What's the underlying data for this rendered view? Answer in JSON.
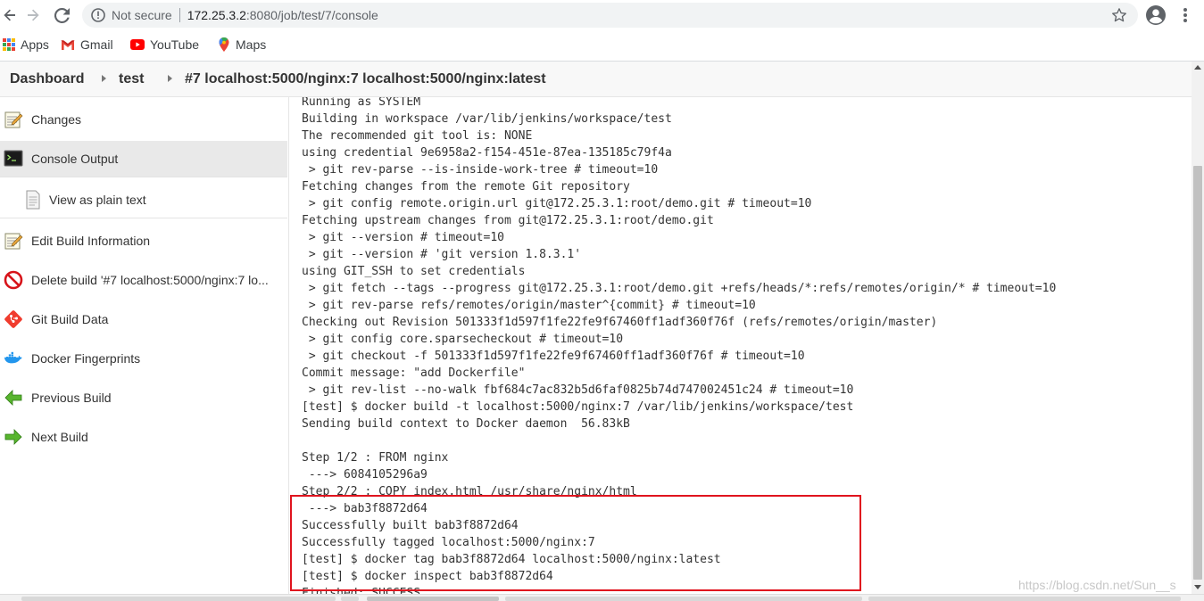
{
  "browser": {
    "security_label": "Not secure",
    "url_host": "172.25.3.2",
    "url_rest": ":8080/job/test/7/console",
    "bookmarks": [
      {
        "label": "Apps",
        "icon": "apps-grid-icon"
      },
      {
        "label": "Gmail",
        "icon": "gmail-icon"
      },
      {
        "label": "YouTube",
        "icon": "youtube-icon"
      },
      {
        "label": "Maps",
        "icon": "maps-icon"
      }
    ]
  },
  "breadcrumb": {
    "items": [
      "Dashboard",
      "test",
      "#7 localhost:5000/nginx:7 localhost:5000/nginx:latest"
    ]
  },
  "sidebar": {
    "items": [
      {
        "label": "Changes",
        "icon": "notepad-icon"
      },
      {
        "label": "Console Output",
        "icon": "terminal-icon",
        "active": true
      },
      {
        "label": "View as plain text",
        "icon": "document-icon",
        "sub": true
      },
      {
        "label": "Edit Build Information",
        "icon": "notepad-icon"
      },
      {
        "label": "Delete build '#7 localhost:5000/nginx:7 lo...",
        "icon": "no-entry-icon"
      },
      {
        "label": "Git Build Data",
        "icon": "git-icon"
      },
      {
        "label": "Docker Fingerprints",
        "icon": "docker-icon"
      },
      {
        "label": "Previous Build",
        "icon": "arrow-left-icon"
      },
      {
        "label": "Next Build",
        "icon": "arrow-right-icon"
      }
    ]
  },
  "console": {
    "lines": [
      "Running as SYSTEM",
      "Building in workspace /var/lib/jenkins/workspace/test",
      "The recommended git tool is: NONE",
      "using credential 9e6958a2-f154-451e-87ea-135185c79f4a",
      " > git rev-parse --is-inside-work-tree # timeout=10",
      "Fetching changes from the remote Git repository",
      " > git config remote.origin.url git@172.25.3.1:root/demo.git # timeout=10",
      "Fetching upstream changes from git@172.25.3.1:root/demo.git",
      " > git --version # timeout=10",
      " > git --version # 'git version 1.8.3.1'",
      "using GIT_SSH to set credentials",
      " > git fetch --tags --progress git@172.25.3.1:root/demo.git +refs/heads/*:refs/remotes/origin/* # timeout=10",
      " > git rev-parse refs/remotes/origin/master^{commit} # timeout=10",
      "Checking out Revision 501333f1d597f1fe22fe9f67460ff1adf360f76f (refs/remotes/origin/master)",
      " > git config core.sparsecheckout # timeout=10",
      " > git checkout -f 501333f1d597f1fe22fe9f67460ff1adf360f76f # timeout=10",
      "Commit message: \"add Dockerfile\"",
      " > git rev-list --no-walk fbf684c7ac832b5d6faf0825b74d747002451c24 # timeout=10",
      "[test] $ docker build -t localhost:5000/nginx:7 /var/lib/jenkins/workspace/test",
      "Sending build context to Docker daemon  56.83kB",
      "",
      "Step 1/2 : FROM nginx",
      " ---> 6084105296a9",
      "Step 2/2 : COPY index.html /usr/share/nginx/html",
      " ---> bab3f8872d64",
      "Successfully built bab3f8872d64",
      "Successfully tagged localhost:5000/nginx:7",
      "[test] $ docker tag bab3f8872d64 localhost:5000/nginx:latest",
      "[test] $ docker inspect bab3f8872d64",
      "Finished: SUCCESS"
    ]
  },
  "watermark": "https://blog.csdn.net/Sun__s",
  "colors": {
    "highlight_box": "#e0141e",
    "console_text": "#333333",
    "active_item_bg": "#e9e9e9"
  }
}
